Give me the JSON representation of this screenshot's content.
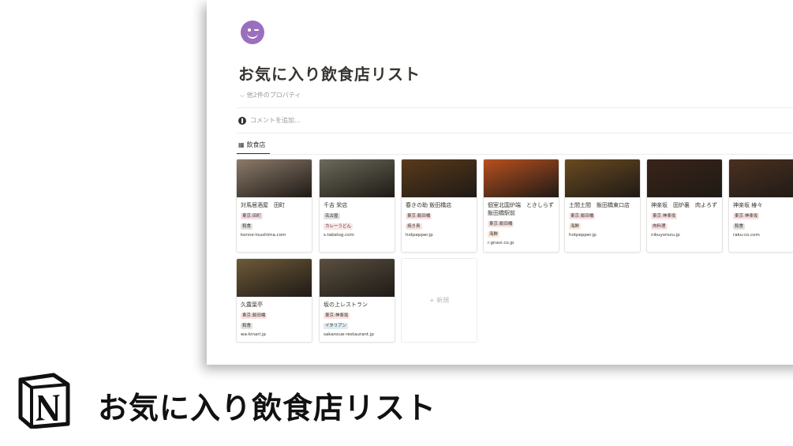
{
  "page": {
    "emoji": "winking-face-icon",
    "title": "お気に入り飲食店リスト",
    "properties_toggle": "他2件のプロパティ",
    "comment_placeholder": "コメントを追加...",
    "view_tab": "飲食店",
    "new_label": "+ 新規"
  },
  "cards": [
    {
      "name": "対馬居酒屋　田町",
      "tags": [
        {
          "text": "東京:田町",
          "color": "#f5e0e9"
        },
        {
          "text": "和食",
          "color": "#e3e2e0"
        }
      ],
      "url": "konne-tsushima.com",
      "img": "#8c7a6a"
    },
    {
      "name": "千吉 栄店",
      "tags": [
        {
          "text": "名古屋",
          "color": "#e3e2e0"
        },
        {
          "text": "カレーうどん",
          "color": "#fbe4e4"
        }
      ],
      "url": "s.tabelog.com",
      "img": "#6b6a5a"
    },
    {
      "name": "春きの助 飯田橋店",
      "tags": [
        {
          "text": "東京:飯田橋",
          "color": "#fbe4e4"
        },
        {
          "text": "焼き鳥",
          "color": "#fbe4e4"
        }
      ],
      "url": "hotpepper.jp",
      "img": "#5a3a1a"
    },
    {
      "name": "個室北国炉端　ときしらず\n飯田橋駅前",
      "tags": [
        {
          "text": "東京:飯田橋",
          "color": "#fbe4e4"
        },
        {
          "text": "海鮮",
          "color": "#fbecdd"
        }
      ],
      "url": "r.gnavi.co.jp",
      "img": "#b8501e"
    },
    {
      "name": "土間土間　飯田橋東口店",
      "tags": [
        {
          "text": "東京:飯田橋",
          "color": "#fbe4e4"
        },
        {
          "text": "海鮮",
          "color": "#fbecdd"
        }
      ],
      "url": "hotpepper.jp",
      "img": "#6a4a20"
    },
    {
      "name": "神楽坂　固炉裏　肉よろず",
      "tags": [
        {
          "text": "東京:神楽坂",
          "color": "#fbe4e4"
        },
        {
          "text": "肉料理",
          "color": "#fbe4e4"
        }
      ],
      "url": "nikuyorozu.jp",
      "img": "#3a2418"
    },
    {
      "name": "神楽坂 椿々",
      "tags": [
        {
          "text": "東京:神楽坂",
          "color": "#fbe4e4"
        },
        {
          "text": "和食",
          "color": "#e3e2e0"
        }
      ],
      "url": "raku-co.com",
      "img": "#4a3020"
    },
    {
      "name": "久露葉亭",
      "tags": [
        {
          "text": "東京:飯田橋",
          "color": "#fbe4e4"
        },
        {
          "text": "和食",
          "color": "#e3e2e0"
        }
      ],
      "url": "wa-kinari.jp",
      "img": "#6e5a38"
    },
    {
      "name": "坂の上レストラン",
      "tags": [
        {
          "text": "東京:神楽坂",
          "color": "#fbe4e4"
        },
        {
          "text": "イタリアン",
          "color": "#ddebf1"
        }
      ],
      "url": "sakanoue-restaurant.jp",
      "img": "#5a5040"
    }
  ],
  "banner": {
    "logo": "notion-logo-icon",
    "title": "お気に入り飲食店リスト"
  }
}
